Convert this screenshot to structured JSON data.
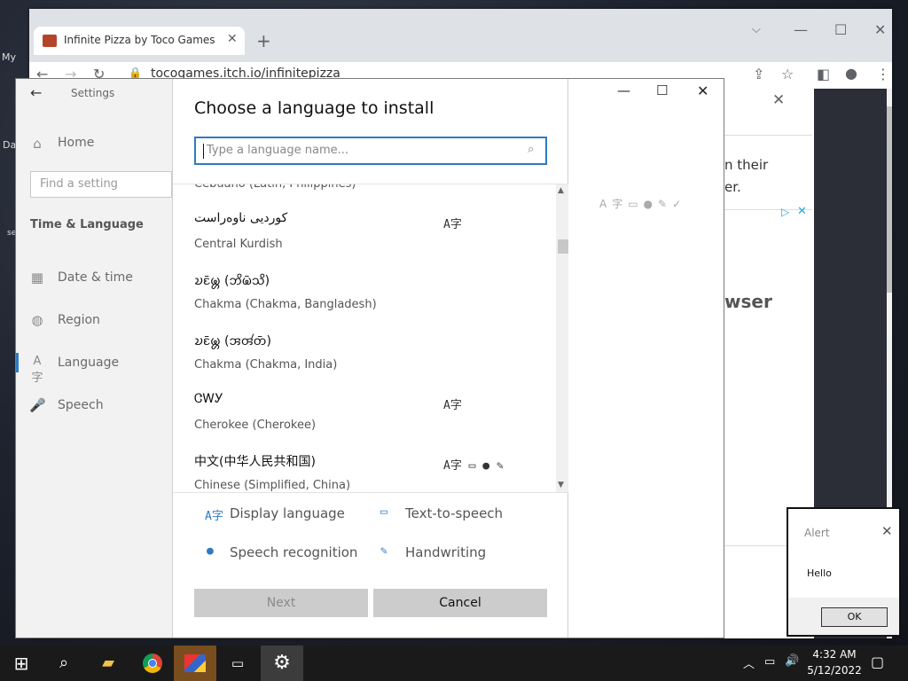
{
  "desktop": {
    "labels": [
      "My",
      "Da",
      "se"
    ]
  },
  "browser": {
    "tab_title": "Infinite Pizza by Toco Games",
    "url": "tocogames.itch.io/infinitepizza",
    "page_text_1": "n their",
    "page_text_2": "er.",
    "page_heading": "wser"
  },
  "settings": {
    "title": "Settings",
    "home": "Home",
    "search_placeholder": "Find a setting",
    "section": "Time & Language",
    "nav": [
      "Date & time",
      "Region",
      "Language",
      "Speech"
    ]
  },
  "dialog": {
    "title": "Choose a language to install",
    "search_placeholder": "Type a language name...",
    "partial_item": "Cebuano (Latin, Philippines)",
    "languages": [
      {
        "native": "کوردیی ناوەراست",
        "english": "Central Kurdish",
        "features": "A字"
      },
      {
        "native": "𑄌𑄋𑄴𑄟𑄳𑄦 (𑄃𑄨𑄟𑄴𑄥𑄨)",
        "english": "Chakma (Chakma, Bangladesh)",
        "features": ""
      },
      {
        "native": "𑄌𑄋𑄴𑄟𑄳𑄦 (𑄞𑄢𑄧𑄖𑄴)",
        "english": "Chakma (Chakma, India)",
        "features": ""
      },
      {
        "native": "ᏣᎳᎩ",
        "english": "Cherokee (Cherokee)",
        "features": "A字"
      },
      {
        "native": "中文(中华人民共和国)",
        "english": "Chinese (Simplified, China)",
        "features": "A字 ▭ ● ✎"
      }
    ],
    "legend": {
      "display": "Display language",
      "tts": "Text-to-speech",
      "speech": "Speech recognition",
      "handwriting": "Handwriting"
    },
    "next": "Next",
    "cancel": "Cancel"
  },
  "alert": {
    "title": "Alert",
    "message": "Hello",
    "ok": "OK"
  },
  "taskbar": {
    "time": "4:32 AM",
    "date": "5/12/2022"
  }
}
